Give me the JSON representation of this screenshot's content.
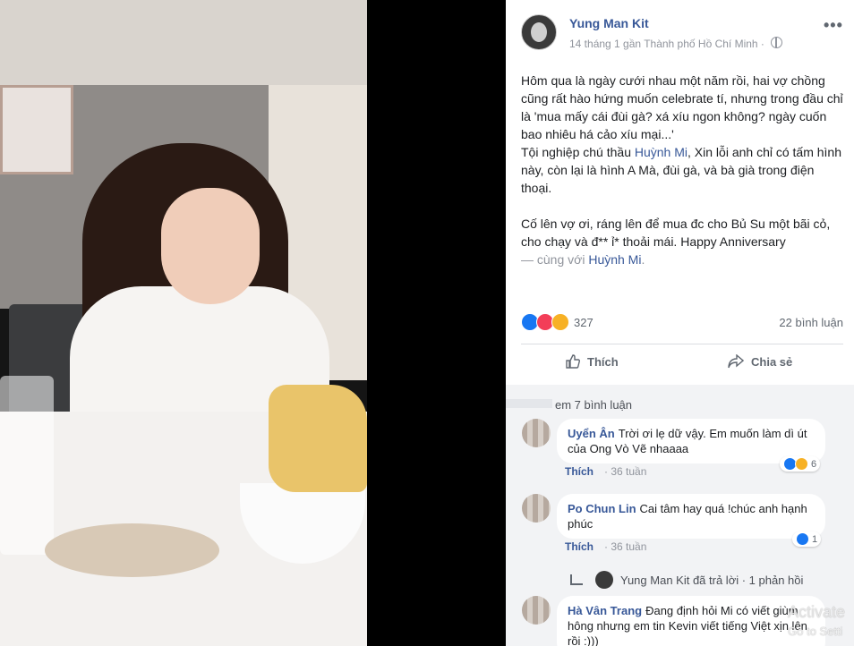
{
  "post": {
    "author": "Yung Man Kit",
    "meta": "14 tháng 1 gần Thành phố Hồ Chí Minh ·",
    "more_icon": "more-icon",
    "text_p1_a": "Hôm qua là ngày cưới nhau một năm rồi, hai vợ chồng cũng rất hào hứng muốn celebrate tí, nhưng trong đầu chỉ là 'mua mấy cái đùi gà? xá xíu ngon không? ngày cuốn bao nhiêu há cảo xíu mại...'",
    "text_p1_b": "Tội nghiệp chú thầu ",
    "text_p1_tag": "Huỳnh Mi",
    "text_p1_c": ", Xin lỗi anh chỉ có tấm hình này, còn lại là hình A Mà, đùi gà, và bà già trong điện thoại.",
    "text_p2": "Cố lên vợ ơi, ráng lên để mua đc cho Bủ Su một bãi cỏ, cho chạy và đ** ỉ* thoải mái. Happy Anniversary",
    "with_prefix": "— cùng với ",
    "with_tag": "Huỳnh Mi",
    "with_suffix": "."
  },
  "stats": {
    "reaction_count": "327",
    "comments": "22 bình luận",
    "reaction_icons": [
      "like-reaction-icon",
      "love-reaction-icon",
      "haha-reaction-icon"
    ]
  },
  "actions": {
    "like_label": "Thích",
    "share_label": "Chia sẻ"
  },
  "comments_section": {
    "view_more": "em 7 bình luận",
    "items": [
      {
        "name": "Uyển Ân",
        "text": "Trời ơi lẹ dữ vậy. Em muốn làm dì út của Ong Vò Vẽ nhaaaa",
        "like": "Thích",
        "time": "36 tuần",
        "reactions": "6"
      },
      {
        "name": "Po Chun Lin",
        "text": "Cai tâm hay quá !chúc anh hạnh phúc",
        "like": "Thích",
        "time": "36 tuần",
        "reactions": "1"
      },
      {
        "name": "Hà Vân Trang",
        "text": "Đang định hỏi Mi có viết giùm hông nhưng em tin Kevin viết tiếng Việt xịn lên rồi :)))"
      }
    ],
    "reply": {
      "author": "Yung Man Kit",
      "text": "đã trả lời",
      "count": "· 1 phản hồi"
    }
  },
  "watermark": {
    "line1": "Activate",
    "line2": "Go to Setti"
  },
  "colors": {
    "link": "#385898",
    "muted": "#90949c",
    "like_blue": "#1877f2",
    "love_red": "#f33e58",
    "haha_yellow": "#f7b125"
  }
}
